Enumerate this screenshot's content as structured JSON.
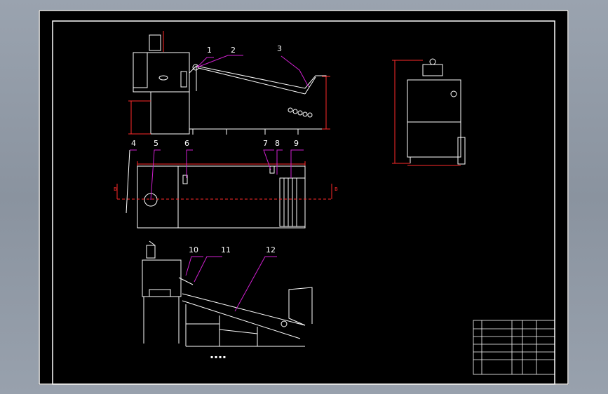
{
  "balloons": [
    {
      "label": "1"
    },
    {
      "label": "2"
    },
    {
      "label": "3"
    },
    {
      "label": "4"
    },
    {
      "label": "5"
    },
    {
      "label": "6"
    },
    {
      "label": "7"
    },
    {
      "label": "8"
    },
    {
      "label": "9"
    },
    {
      "label": "10"
    },
    {
      "label": "11"
    },
    {
      "label": "12"
    }
  ],
  "section_marks": {
    "left": "B",
    "right": "B"
  },
  "colors": {
    "background": "#000000",
    "outline": "#ffffff",
    "dimension": "#ff2a2a",
    "leader": "#d020d0",
    "steel": "#e8e8e8"
  }
}
